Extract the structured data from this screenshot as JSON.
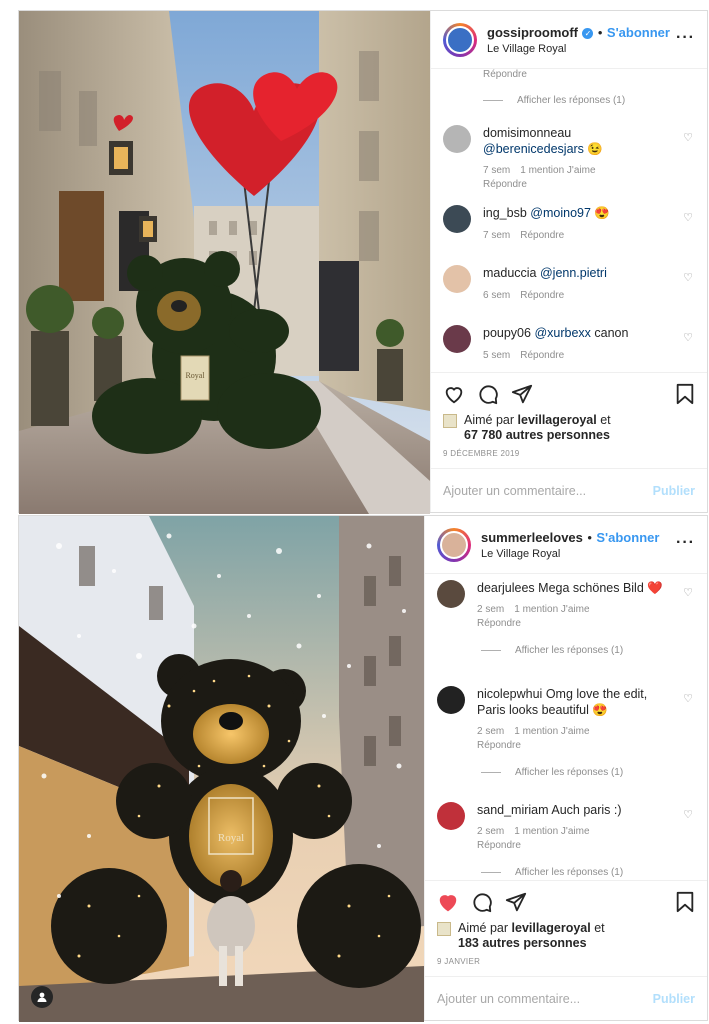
{
  "post1": {
    "username": "gossiproomoff",
    "follow_label": "S'abonner",
    "location": "Le Village Royal",
    "top_reply_cut": "Répondre",
    "top_view_replies": "Afficher les réponses (1)",
    "comments": [
      {
        "user": "domisimonneau",
        "mention": "@berenicedesjars",
        "text": "",
        "emoji": "😉",
        "time": "7 sem",
        "likes": "1 mention J'aime",
        "reply": "Répondre"
      },
      {
        "user": "ing_bsb",
        "mention": "@moino97",
        "text": "",
        "emoji": "😍",
        "time": "7 sem",
        "reply": "Répondre"
      },
      {
        "user": "maduccia",
        "mention": "@jenn.pietri",
        "text": "",
        "time": "6 sem",
        "reply": "Répondre"
      },
      {
        "user": "poupy06",
        "mention": "@xurbexx",
        "text": "canon",
        "time": "5 sem",
        "reply": "Répondre"
      }
    ],
    "liked_by_prefix": "Aimé par",
    "liked_by_user": "levillageroyal",
    "liked_by_and": "et",
    "liked_by_others": "67 780 autres personnes",
    "date": "9 DÉCEMBRE 2019",
    "comment_placeholder": "Ajouter un commentaire...",
    "publish_label": "Publier",
    "sign_text": "Royal"
  },
  "post2": {
    "username": "summerleeloves",
    "follow_label": "S'abonner",
    "location": "Le Village Royal",
    "comments": [
      {
        "user": "dearjulees",
        "text": "Mega schönes Bild",
        "emoji": "❤️",
        "time": "2 sem",
        "likes": "1 mention J'aime",
        "reply": "Répondre",
        "view_replies": "Afficher les réponses (1)"
      },
      {
        "user": "nicolepwhui",
        "text": "Omg love the edit, Paris looks beautiful",
        "emoji": "😍",
        "time": "2 sem",
        "likes": "1 mention J'aime",
        "reply": "Répondre",
        "view_replies": "Afficher les réponses (1)"
      },
      {
        "user": "sand_miriam",
        "text": "Auch paris :)",
        "time": "2 sem",
        "likes": "1 mention J'aime",
        "reply": "Répondre",
        "view_replies": "Afficher les réponses (1)"
      }
    ],
    "liked_by_prefix": "Aimé par",
    "liked_by_user": "levillageroyal",
    "liked_by_and": "et",
    "liked_by_others": "183 autres personnes",
    "date": "9 JANVIER",
    "comment_placeholder": "Ajouter un commentaire...",
    "publish_label": "Publier",
    "sign_text": "Royal"
  },
  "colors": {
    "link": "#3897f0",
    "like_red": "#ed4956",
    "mention": "#00376b",
    "muted": "#8e8e8e"
  }
}
